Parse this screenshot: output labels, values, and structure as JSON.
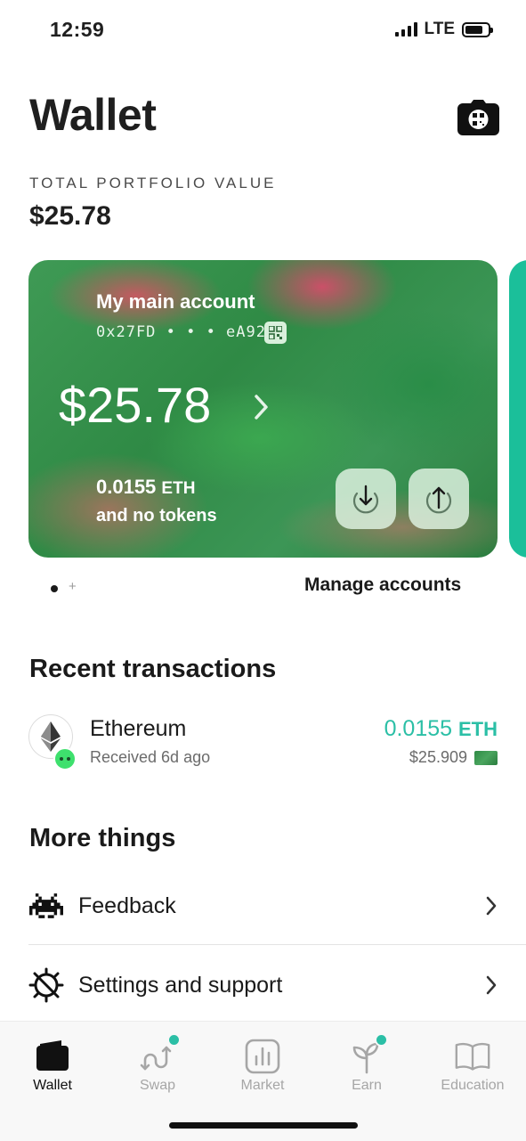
{
  "status": {
    "time": "12:59",
    "network": "LTE"
  },
  "header": {
    "title": "Wallet"
  },
  "portfolio": {
    "label": "TOTAL PORTFOLIO VALUE",
    "value": "$25.78"
  },
  "card": {
    "name": "My main account",
    "address": "0x27FD • • • eA92",
    "balance": "$25.78",
    "eth_amount": "0.0155",
    "eth_unit": "ETH",
    "tokens_text": "and no tokens"
  },
  "accounts": {
    "pager_plus": "+",
    "manage_label": "Manage accounts"
  },
  "recent": {
    "title": "Recent transactions",
    "items": [
      {
        "name": "Ethereum",
        "subtitle": "Received 6d ago",
        "amount": "0.0155",
        "unit": "ETH",
        "usd": "$25.909"
      }
    ]
  },
  "more": {
    "title": "More things",
    "items": [
      {
        "label": "Feedback",
        "icon": "space-invader-icon"
      },
      {
        "label": "Settings and support",
        "icon": "gear-icon"
      }
    ]
  },
  "tabs": [
    {
      "label": "Wallet",
      "icon": "wallet-icon",
      "active": true
    },
    {
      "label": "Swap",
      "icon": "swap-icon",
      "badge": true
    },
    {
      "label": "Market",
      "icon": "market-icon"
    },
    {
      "label": "Earn",
      "icon": "sprout-icon",
      "badge": true
    },
    {
      "label": "Education",
      "icon": "book-icon"
    }
  ],
  "colors": {
    "accent": "#2bbfa6",
    "card_green": "#2f8a45",
    "card_pink": "#e0466e",
    "text": "#1a1a1a"
  }
}
